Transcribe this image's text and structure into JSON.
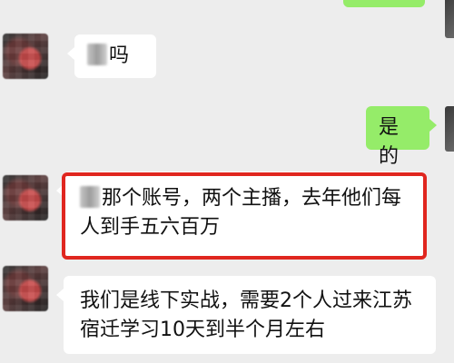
{
  "chat": {
    "messages": [
      {
        "id": "msg1",
        "direction": "incoming",
        "redacted_prefix": true,
        "text": "吗"
      },
      {
        "id": "msg2",
        "direction": "outgoing",
        "text": "是的"
      },
      {
        "id": "msg3",
        "direction": "incoming",
        "redacted_prefix": true,
        "highlighted": true,
        "text": "那个账号，两个主播，去年他们每人到手五六百万"
      },
      {
        "id": "msg4",
        "direction": "incoming",
        "text": "我们是线下实战，需要2个人过来江苏宿迁学习10天到半个月左右"
      }
    ],
    "colors": {
      "background": "#ededed",
      "incoming_bubble": "#ffffff",
      "outgoing_bubble": "#95ec69",
      "highlight_border": "#e0261f"
    }
  }
}
